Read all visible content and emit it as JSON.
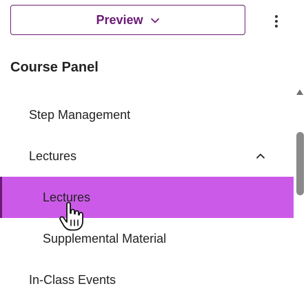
{
  "header": {
    "preview_label": "Preview",
    "preview_icon": "chevron-down-icon",
    "menu_icon": "more-vertical-icon"
  },
  "panel": {
    "title": "Course Panel"
  },
  "nav": {
    "items": [
      {
        "label": "Step Management",
        "level": 1
      },
      {
        "label": "Lectures",
        "level": 1,
        "expanded": true,
        "icon": "chevron-up-icon"
      },
      {
        "label": "Lectures",
        "level": 2,
        "active": true
      },
      {
        "label": "Supplemental Material",
        "level": 2
      },
      {
        "label": "In-Class Events",
        "level": 1
      }
    ]
  },
  "scrollbar": {
    "up_icon": "triangle-up-icon"
  },
  "cursor": {
    "icon": "hand-pointer-icon"
  },
  "colors": {
    "accent": "#6b1a75",
    "active_bg": "#cc5ae8",
    "text": "#222222",
    "scroll_thumb": "#8a8a8a"
  }
}
